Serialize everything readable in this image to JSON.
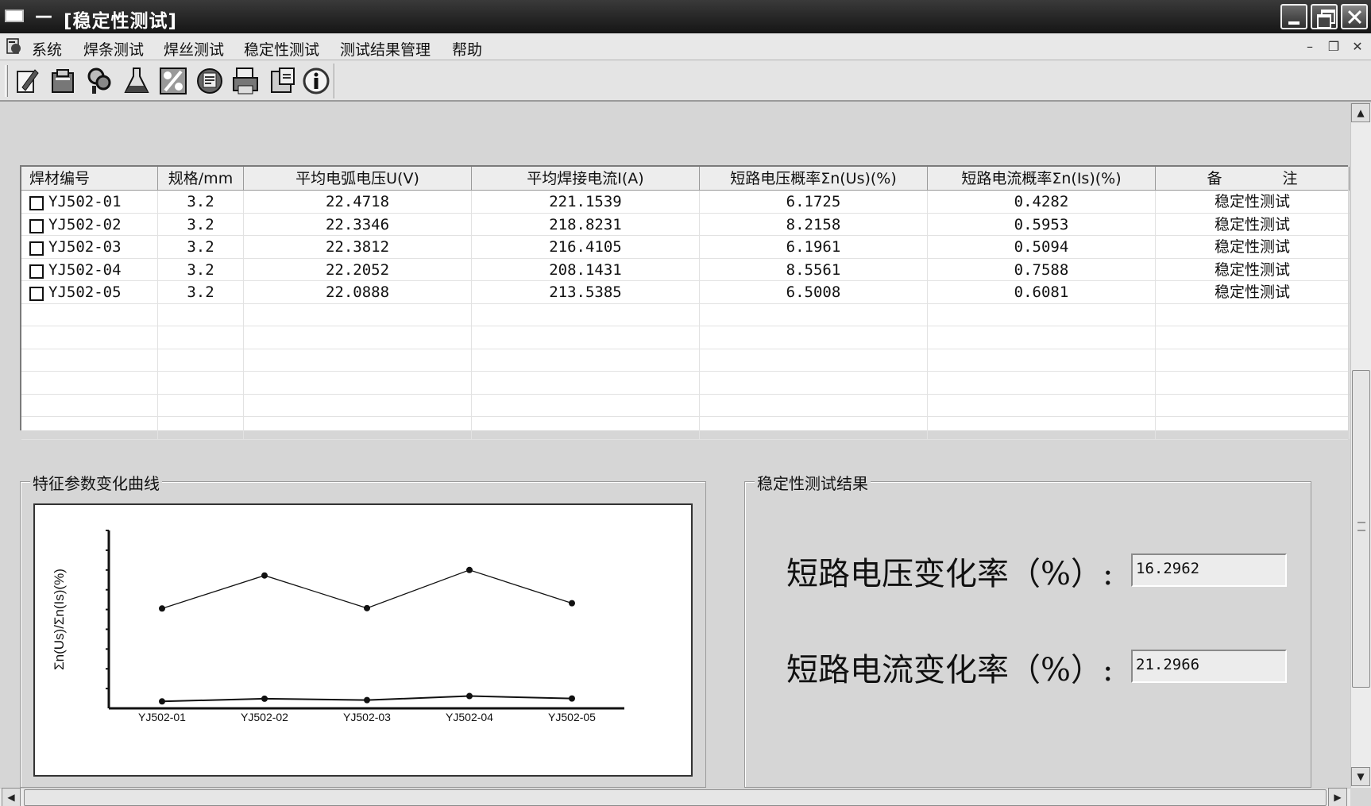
{
  "window": {
    "dash": "—",
    "title": "[稳定性测试]"
  },
  "menu": {
    "items": [
      "系统",
      "焊条测试",
      "焊丝测试",
      "稳定性测试",
      "测试结果管理",
      "帮助"
    ],
    "mdi_min": "–",
    "mdi_restore": "❐",
    "mdi_close": "✕"
  },
  "toolbar": {
    "icons": [
      "edit-icon",
      "clipboard-icon",
      "search-icon",
      "chemistry-icon",
      "percent-icon",
      "report-icon",
      "print-icon",
      "export-icon",
      "info-icon"
    ]
  },
  "grid": {
    "headers": [
      "焊材编号",
      "规格/mm",
      "平均电弧电压U(V)",
      "平均焊接电流I(A)",
      "短路电压概率Σn(Us)(%)",
      "短路电流概率Σn(Is)(%)",
      "备　　　　注"
    ],
    "rows": [
      [
        "YJ502-01",
        "3.2",
        "22.4718",
        "221.1539",
        "6.1725",
        "0.4282",
        "稳定性测试"
      ],
      [
        "YJ502-02",
        "3.2",
        "22.3346",
        "218.8231",
        "8.2158",
        "0.5953",
        "稳定性测试"
      ],
      [
        "YJ502-03",
        "3.2",
        "22.3812",
        "216.4105",
        "6.1961",
        "0.5094",
        "稳定性测试"
      ],
      [
        "YJ502-04",
        "3.2",
        "22.2052",
        "208.1431",
        "8.5561",
        "0.7588",
        "稳定性测试"
      ],
      [
        "YJ502-05",
        "3.2",
        "22.0888",
        "213.5385",
        "6.5008",
        "0.6081",
        "稳定性测试"
      ]
    ]
  },
  "chart_group": {
    "title": "特征参数变化曲线"
  },
  "results_group": {
    "title": "稳定性测试结果",
    "voltage_label": "短路电压变化率（%）:",
    "voltage_value": "16.2962",
    "current_label": "短路电流变化率（%）:",
    "current_value": "21.2966"
  },
  "chart_data": {
    "type": "line",
    "categories": [
      "YJ502-01",
      "YJ502-02",
      "YJ502-03",
      "YJ502-04",
      "YJ502-05"
    ],
    "ylabel": "Σn(Us)/Σn(Is)(%)",
    "ylim": [
      0,
      11
    ],
    "yticks": 9,
    "series": [
      {
        "values": [
          6.1725,
          8.2158,
          6.1961,
          8.5561,
          6.5008
        ]
      },
      {
        "values": [
          0.4282,
          0.5953,
          0.5094,
          0.7588,
          0.6081
        ]
      }
    ],
    "grid": false,
    "legend": "none"
  }
}
